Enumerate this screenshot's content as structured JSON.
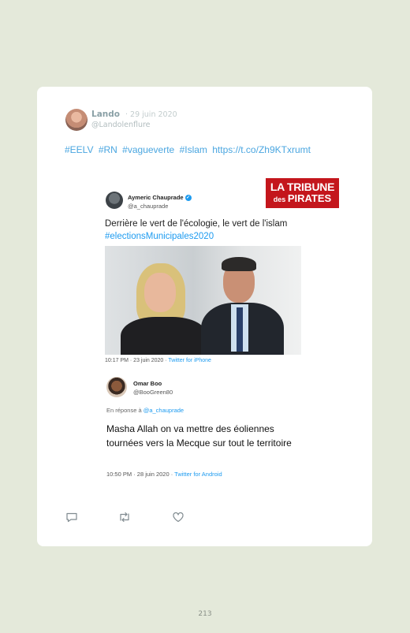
{
  "tweet": {
    "author": {
      "name": "Lando",
      "date": "· 29 juin 2020",
      "handle": "@Landolenflure",
      "avatar": "avatar-icon"
    },
    "text": {
      "tag1": "#EELV",
      "tag2": "#RN",
      "tag3": "#vagueverte",
      "tag4": "#Islam",
      "link": "https://t.co/Zh9KTxrumt"
    },
    "actions": {
      "reply": "reply-icon",
      "retweet": "retweet-icon",
      "like": "heart-icon"
    }
  },
  "embedded": {
    "logo": {
      "line1": "LA TRIBUNE",
      "line2a": "des",
      "line2b": "PIRATES"
    },
    "quote1": {
      "name": "Aymeric Chauprade",
      "handle": "@a_chauprade",
      "text": "Derrière le vert de l'écologie, le vert de l'islam ",
      "hashtag": "#electionsMunicipales2020",
      "meta": "10:17 PM · 23 juin 2020 · ",
      "source": "Twitter for iPhone"
    },
    "quote2": {
      "name": "Omar Boo",
      "handle": "@BooGreen80",
      "reply_prefix": "En réponse à ",
      "reply_to": "@a_chauprade",
      "text": "Masha Allah on va mettre des éoliennes tournées vers la Mecque sur tout le territoire",
      "meta": "10:50 PM · 28 juin 2020 · ",
      "source": "Twitter for Android"
    }
  },
  "page": {
    "number": "213"
  },
  "colors": {
    "background": "#e4e9da",
    "link": "#4aa6e0",
    "twitter_blue": "#1d9bf0",
    "logo_red": "#c4161c"
  }
}
